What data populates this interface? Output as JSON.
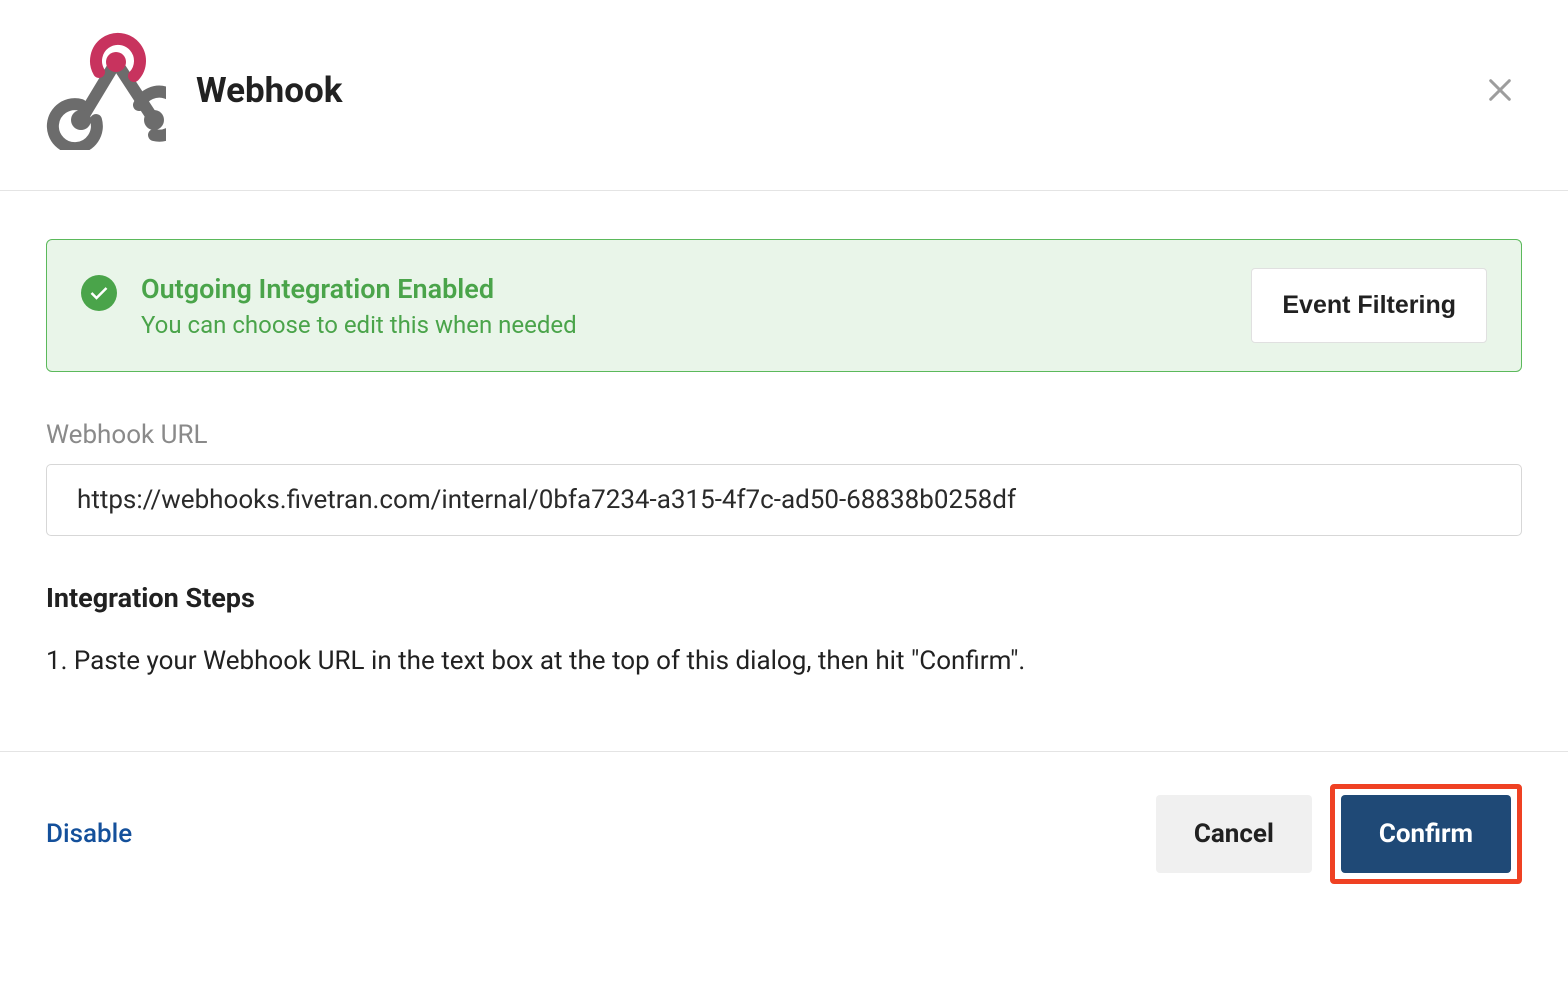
{
  "header": {
    "title": "Webhook"
  },
  "alert": {
    "title": "Outgoing Integration Enabled",
    "subtitle": "You can choose to edit this when needed",
    "button_label": "Event Filtering"
  },
  "url_section": {
    "label": "Webhook URL",
    "value": "https://webhooks.fivetran.com/internal/0bfa7234-a315-4f7c-ad50-68838b0258df"
  },
  "steps": {
    "heading": "Integration Steps",
    "item1": "1. Paste your Webhook URL in the text box at the top of this dialog, then hit \"Confirm\"."
  },
  "footer": {
    "disable_label": "Disable",
    "cancel_label": "Cancel",
    "confirm_label": "Confirm"
  }
}
